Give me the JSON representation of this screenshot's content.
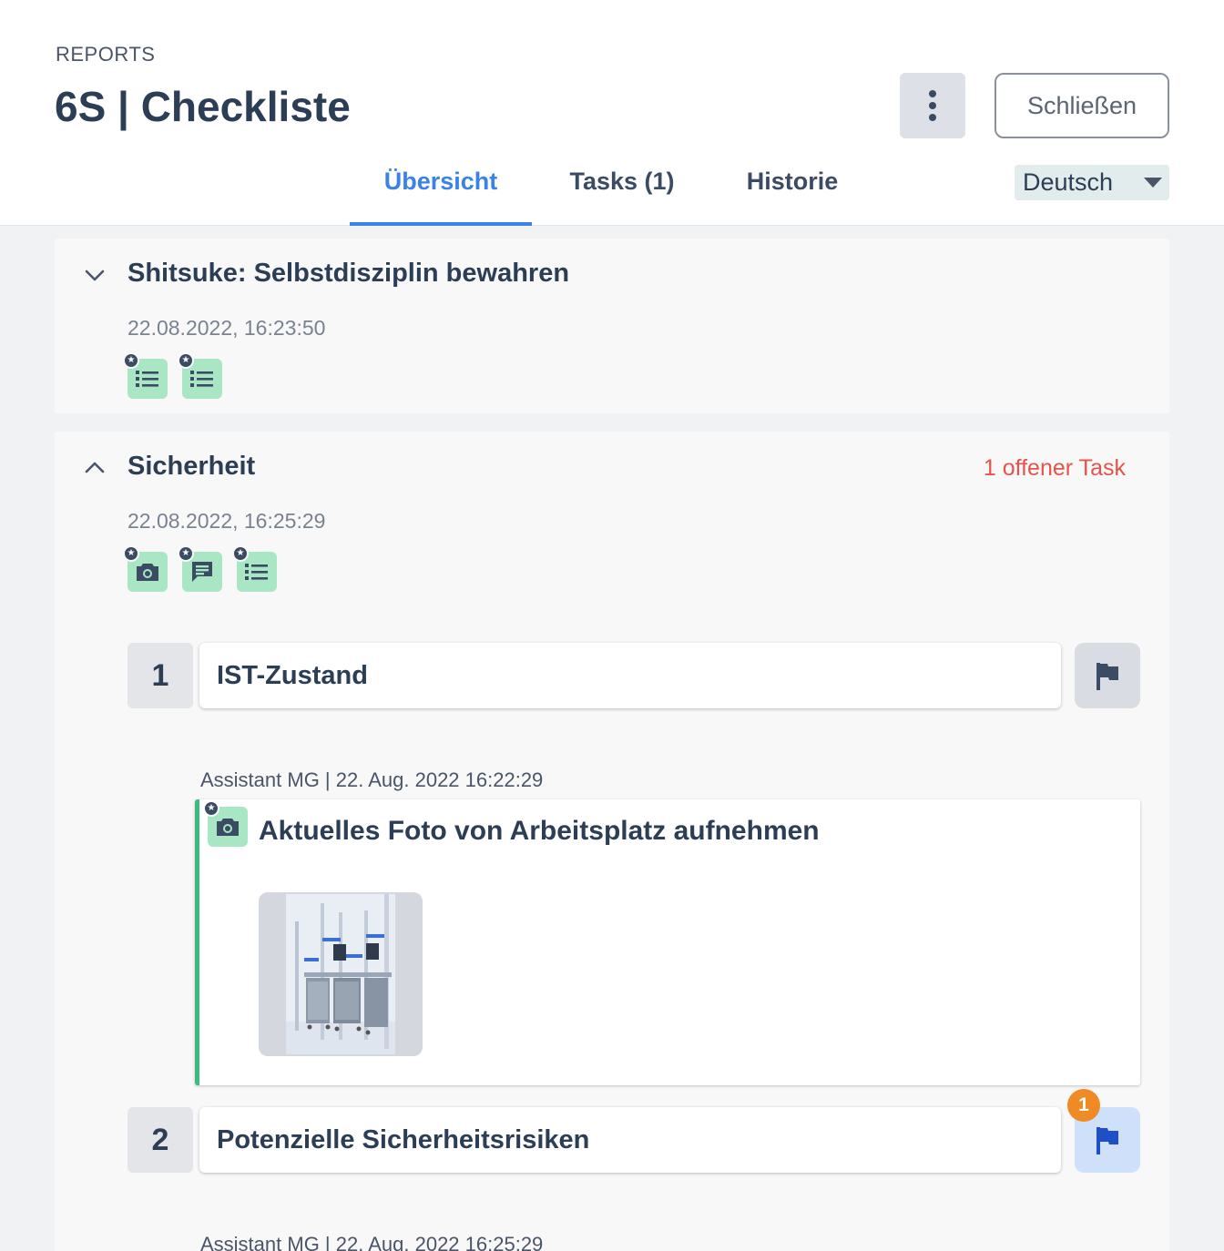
{
  "header": {
    "breadcrumb": "REPORTS",
    "title": "6S | Checkliste",
    "close_label": "Schließen",
    "more_icon": "more-vertical-icon"
  },
  "tabs": [
    {
      "label": "Übersicht",
      "active": true
    },
    {
      "label": "Tasks (1)",
      "active": false
    },
    {
      "label": "Historie",
      "active": false
    }
  ],
  "language": {
    "selected": "Deutsch"
  },
  "sections": [
    {
      "title": "Shitsuke: Selbstdisziplin bewahren",
      "date": "22.08.2022, 16:23:50",
      "expanded": false,
      "badges": [
        "checklist-icon",
        "checklist-icon"
      ]
    },
    {
      "title": "Sicherheit",
      "date": "22.08.2022, 16:25:29",
      "expanded": true,
      "open_tasks": "1 offener Task",
      "badges": [
        "camera-icon",
        "comment-icon",
        "checklist-icon"
      ],
      "questions": [
        {
          "number": "1",
          "label": "IST-Zustand",
          "meta": "Assistant MG | 22. Aug. 2022 16:22:29",
          "answer": {
            "title": "Aktuelles Foto von Arbeitsplatz aufnehmen",
            "type_icon": "camera-icon"
          }
        },
        {
          "number": "2",
          "label": "Potenzielle Sicherheitsrisiken",
          "task_count": "1",
          "meta": "Assistant MG | 22. Aug. 2022 16:25:29"
        }
      ]
    }
  ],
  "colors": {
    "accent": "#3b82e6",
    "badge_bg": "#a8e6c4",
    "answer_border": "#3dbb7d",
    "open_task_text": "#e5534b",
    "notification": "#f08a24"
  }
}
